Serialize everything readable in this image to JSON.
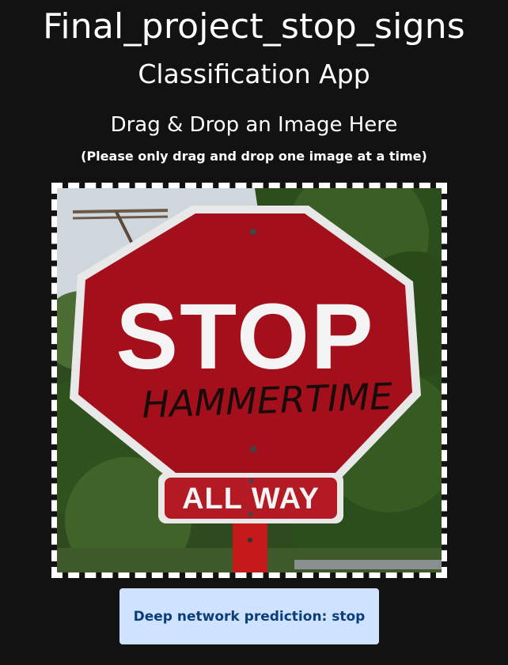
{
  "header": {
    "title": "Final_project_stop_signs",
    "subtitle": "Classification App"
  },
  "dropzone": {
    "heading": "Drag & Drop an Image Here",
    "hint": "(Please only drag and drop one image at a time)",
    "image": {
      "sign_text": "STOP",
      "graffiti_text": "HAMMERTIME",
      "plate_text": "ALL WAY"
    }
  },
  "result": {
    "prediction_label": "Deep network prediction: stop"
  },
  "colors": {
    "background": "#121212",
    "prediction_bg": "#cfe2ff",
    "prediction_text": "#0a3d7a",
    "sign_red": "#a3101c"
  }
}
